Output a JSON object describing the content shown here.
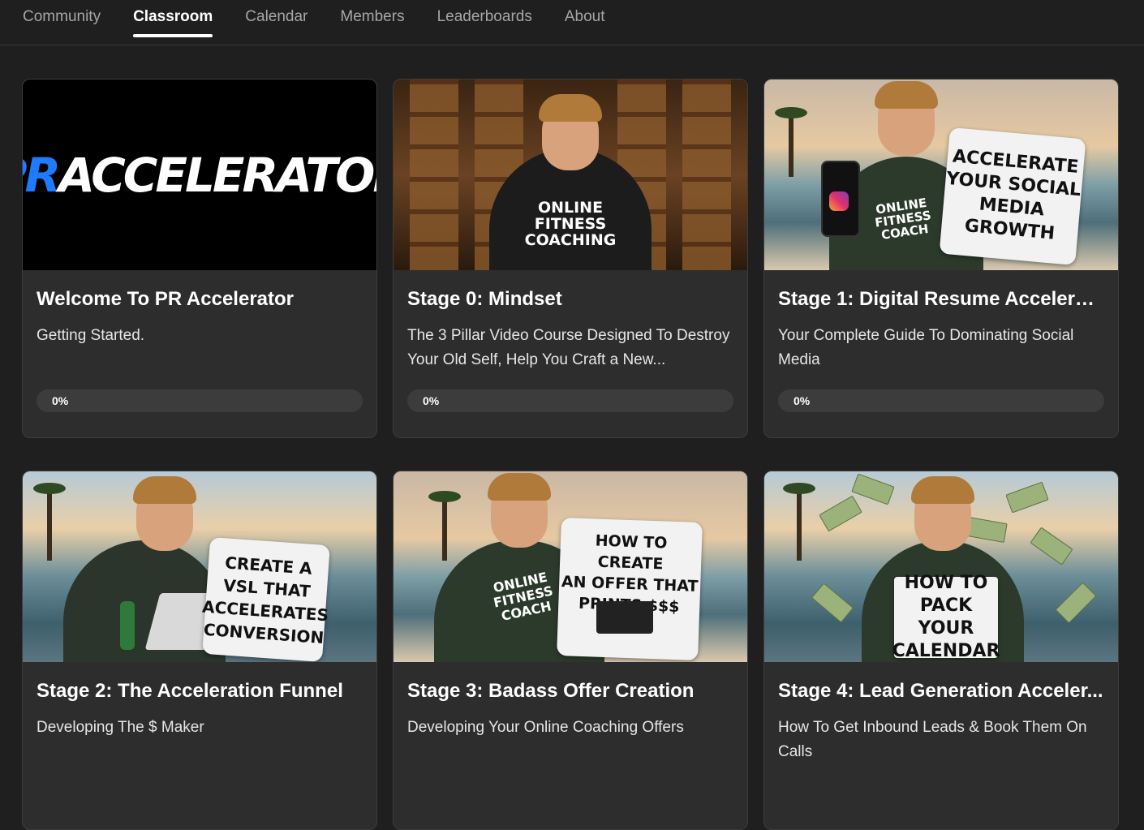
{
  "nav": {
    "tabs": [
      {
        "label": "Community",
        "active": false
      },
      {
        "label": "Classroom",
        "active": true
      },
      {
        "label": "Calendar",
        "active": false
      },
      {
        "label": "Members",
        "active": false
      },
      {
        "label": "Leaderboards",
        "active": false
      },
      {
        "label": "About",
        "active": false
      }
    ]
  },
  "courses": [
    {
      "title": "Welcome To PR Accelerator",
      "description": "Getting Started.",
      "progress_label": "0%",
      "progress": 0,
      "thumbnail": {
        "logo_pr": "PR",
        "logo_rest": "ACCELERATOR"
      }
    },
    {
      "title": "Stage 0: Mindset",
      "description": "The 3 Pillar Video Course Designed To Destroy Your Old Self, Help You Craft a New...",
      "progress_label": "0%",
      "progress": 0,
      "thumbnail": {
        "shirt_text": "ONLINE\nFITNESS\nCOACHING"
      }
    },
    {
      "title": "Stage 1: Digital Resume Accelerat...",
      "description": "Your Complete Guide To Dominating Social Media",
      "progress_label": "0%",
      "progress": 0,
      "thumbnail": {
        "shirt_text": "ONLINE\nFITNESS\nCOACH",
        "sign_text": "ACCELERATE\nYOUR SOCIAL\nMEDIA\nGROWTH"
      }
    },
    {
      "title": "Stage 2: The Acceleration Funnel",
      "description": "Developing The $ Maker",
      "progress_label": "",
      "progress": 0,
      "thumbnail": {
        "sign_text": "CREATE A\nVSL THAT\nACCELERATES\nCONVERSION"
      }
    },
    {
      "title": "Stage 3: Badass Offer Creation",
      "description": "Developing Your Online Coaching Offers",
      "progress_label": "",
      "progress": 0,
      "thumbnail": {
        "shirt_text": "ONLINE\nFITNESS\nCOACH",
        "sign_text": "HOW TO CREATE\nAN OFFER THAT\nPRINTS $$$"
      }
    },
    {
      "title": "Stage 4: Lead Generation Acceler...",
      "description": "How To Get Inbound Leads & Book Them On Calls",
      "progress_label": "",
      "progress": 0,
      "thumbnail": {
        "sign_text": "HOW TO\nPACK YOUR\nCALENDAR"
      }
    }
  ],
  "colors": {
    "background": "#1f1f1f",
    "card": "#2d2d2d",
    "brand_blue": "#1e7bff"
  }
}
